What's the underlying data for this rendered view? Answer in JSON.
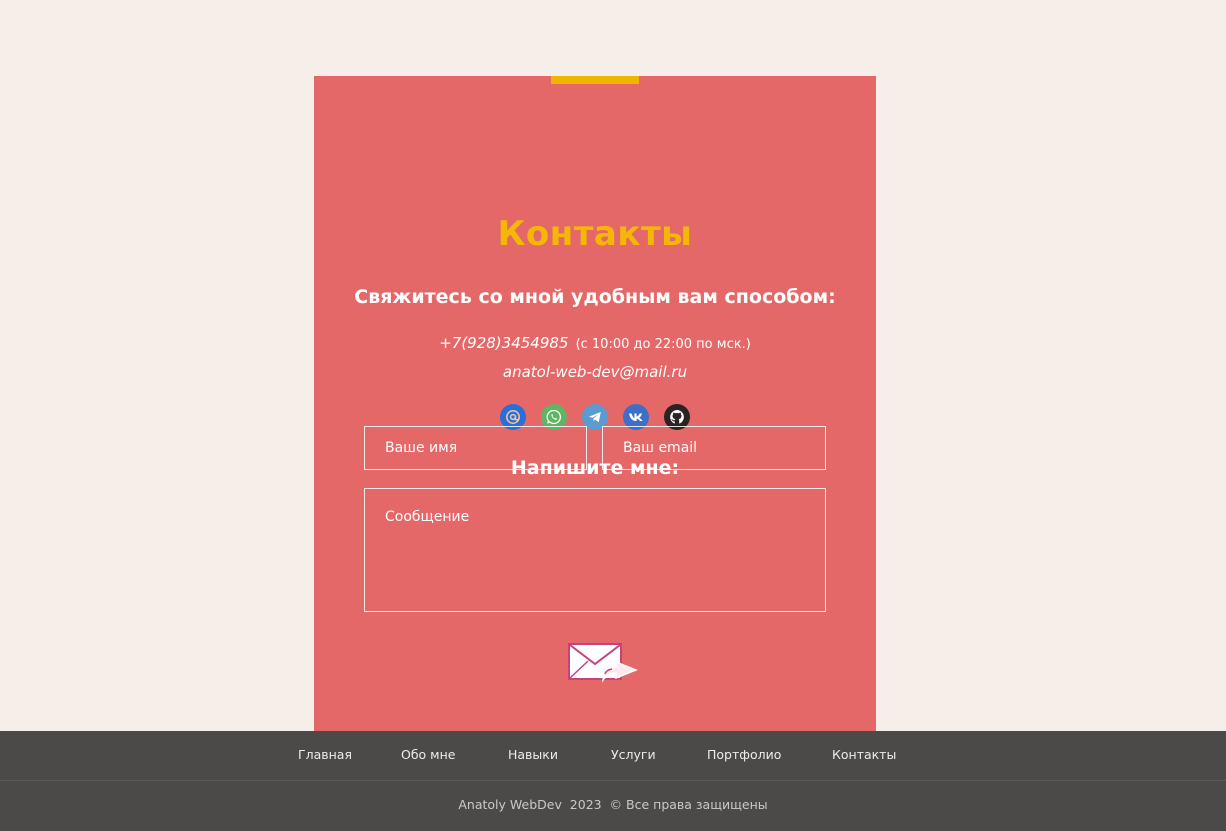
{
  "contacts": {
    "title": "Контакты",
    "subtitle": "Свяжитесь со мной удобным вам способом:",
    "phone": "+7(928)3454985",
    "hours": "(с 10:00 до 22:00 по мск.)",
    "email": "anatol-web-dev@mail.ru",
    "socials": [
      {
        "name": "mail",
        "icon": "at-sign-icon",
        "color": "#2a6fd6"
      },
      {
        "name": "whatsapp",
        "icon": "whatsapp-icon",
        "color": "#5fb563"
      },
      {
        "name": "telegram",
        "icon": "telegram-icon",
        "color": "#5b9bd0"
      },
      {
        "name": "vk",
        "icon": "vk-icon",
        "color": "#3d6ec8"
      },
      {
        "name": "github",
        "icon": "github-icon",
        "color": "#2b2222"
      }
    ]
  },
  "form": {
    "title": "Напишите мне:",
    "name_placeholder": "Ваше имя",
    "email_placeholder": "Ваш email",
    "message_placeholder": "Сообщение",
    "send_icon": "send-envelope-icon"
  },
  "nav": {
    "items": [
      "Главная",
      "Обо мне",
      "Навыки",
      "Услуги",
      "Портфолио",
      "Контакты"
    ]
  },
  "footer": {
    "copyright": "Anatoly WebDev  2023  © Все права защищены"
  },
  "colors": {
    "page_bg": "#f6eee9",
    "card_bg": "#e56868",
    "accent": "#f0b500",
    "footer_bg": "#4b4a49"
  }
}
